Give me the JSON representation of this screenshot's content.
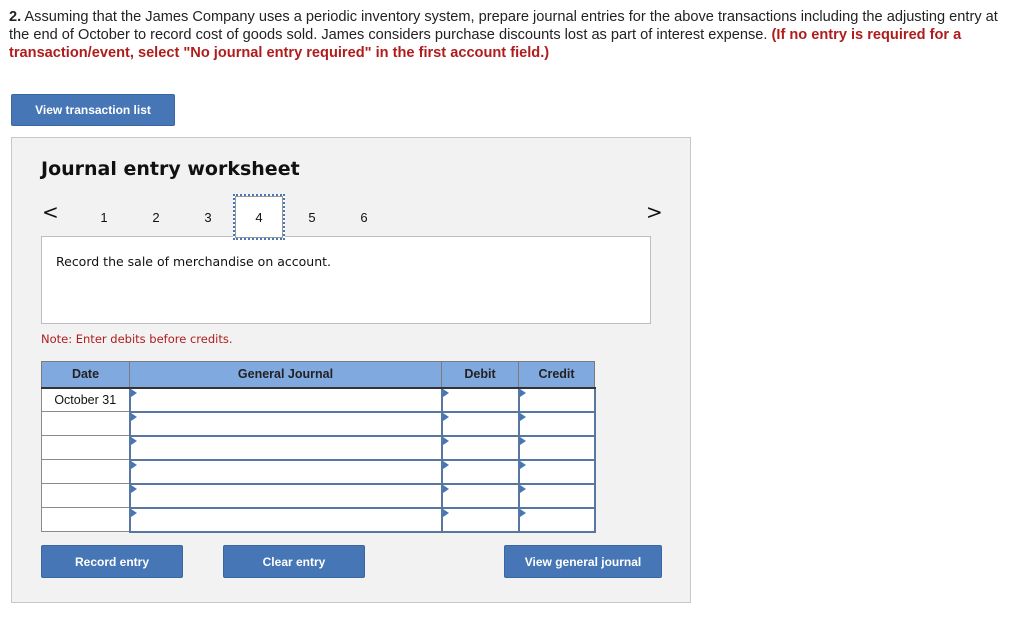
{
  "question": {
    "number": "2.",
    "text": " Assuming that the James Company uses a periodic inventory system, prepare journal entries for the above transactions including the adjusting entry at the end of October to record cost of goods sold. James considers purchase discounts lost as part of interest expense. ",
    "instruction": "(If no entry is required for a transaction/event, select \"No journal entry required\" in the first account field.)"
  },
  "buttons": {
    "view_transaction_list": "View transaction list",
    "record_entry": "Record entry",
    "clear_entry": "Clear entry",
    "view_general_journal": "View general journal"
  },
  "worksheet": {
    "title": "Journal entry worksheet",
    "pages": [
      "1",
      "2",
      "3",
      "4",
      "5",
      "6"
    ],
    "active_page": "4",
    "prev_icon": "chevron-left-icon",
    "next_icon": "chevron-right-icon",
    "prev_glyph": "<",
    "next_glyph": ">",
    "description": "Record the sale of merchandise on account.",
    "note": "Note: Enter debits before credits."
  },
  "journal_table": {
    "headers": {
      "date": "Date",
      "general_journal": "General Journal",
      "debit": "Debit",
      "credit": "Credit"
    },
    "rows": [
      {
        "date": "October 31",
        "account": "",
        "debit": "",
        "credit": ""
      },
      {
        "date": "",
        "account": "",
        "debit": "",
        "credit": ""
      },
      {
        "date": "",
        "account": "",
        "debit": "",
        "credit": ""
      },
      {
        "date": "",
        "account": "",
        "debit": "",
        "credit": ""
      },
      {
        "date": "",
        "account": "",
        "debit": "",
        "credit": ""
      },
      {
        "date": "",
        "account": "",
        "debit": "",
        "credit": ""
      }
    ]
  },
  "colors": {
    "button_blue": "#4676b6",
    "header_blue": "#80a9df",
    "warning_red": "#b01c1c",
    "panel_bg": "#f2f2f2"
  }
}
